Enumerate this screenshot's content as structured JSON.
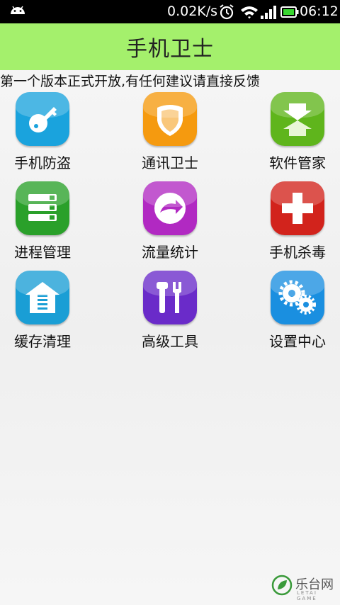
{
  "status_bar": {
    "net_speed": "0.02K/s",
    "time": "06:12",
    "icons": [
      "android-icon",
      "alarm-icon",
      "wifi-icon",
      "signal-icon",
      "battery-icon"
    ]
  },
  "header": {
    "title": "手机卫士"
  },
  "notice": "第一个版本正式开放,有任何建议请直接反馈",
  "grid": [
    {
      "label": "手机防盗",
      "icon": "key-icon",
      "color": "#1aa3dd"
    },
    {
      "label": "通讯卫士",
      "icon": "shield-icon",
      "color": "#f59a0f"
    },
    {
      "label": "软件管家",
      "icon": "arrows-icon",
      "color": "#5fb51c"
    },
    {
      "label": "进程管理",
      "icon": "list-icon",
      "color": "#2aa02a"
    },
    {
      "label": "流量统计",
      "icon": "flow-arrow-icon",
      "color": "#b129c2"
    },
    {
      "label": "手机杀毒",
      "icon": "cross-icon",
      "color": "#d2231c"
    },
    {
      "label": "缓存清理",
      "icon": "house-icon",
      "color": "#1a9ed5"
    },
    {
      "label": "高级工具",
      "icon": "tools-icon",
      "color": "#6a2bc9"
    },
    {
      "label": "设置中心",
      "icon": "gears-icon",
      "color": "#1a8fe0"
    }
  ],
  "watermark": {
    "text": "乐台网",
    "sub": "LETAI GAME"
  }
}
